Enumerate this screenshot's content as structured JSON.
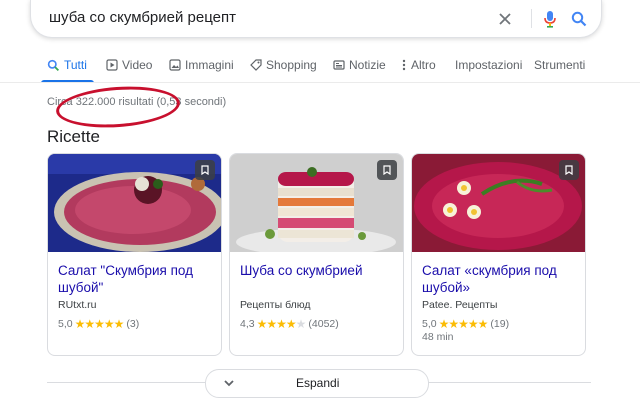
{
  "search": {
    "query": "шуба со скумбрией рецепт"
  },
  "tabs": [
    {
      "label": "Tutti",
      "icon": "search-icon",
      "active": true
    },
    {
      "label": "Video",
      "icon": "video-icon"
    },
    {
      "label": "Immagini",
      "icon": "image-icon"
    },
    {
      "label": "Shopping",
      "icon": "tag-icon"
    },
    {
      "label": "Notizie",
      "icon": "news-icon"
    },
    {
      "label": "Altro",
      "icon": "more-vert-icon"
    },
    {
      "label": "Impostazioni"
    },
    {
      "label": "Strumenti"
    }
  ],
  "results_stats": "Circa 322.000 risultati (0,53 secondi)",
  "section_title": "Ricette",
  "recipes": [
    {
      "title": "Салат \"Скумбрия под шубой\"",
      "source": "RUtxt.ru",
      "rating": "5,0",
      "stars": 5,
      "reviews": "(3)",
      "time": ""
    },
    {
      "title": "Шуба со скумбрией",
      "source": "Рецепты блюд",
      "rating": "4,3",
      "stars": 4.3,
      "reviews": "(4052)",
      "time": ""
    },
    {
      "title": "Салат «скумбрия под шубой»",
      "source": "Patee. Рецепты",
      "rating": "5,0",
      "stars": 5,
      "reviews": "(19)",
      "time": "48 min"
    }
  ],
  "expand_label": "Espandi",
  "colors": {
    "accent": "#1a73e8",
    "link": "#1a0dab",
    "star": "#fbbc04",
    "annotation": "#c8102e"
  }
}
